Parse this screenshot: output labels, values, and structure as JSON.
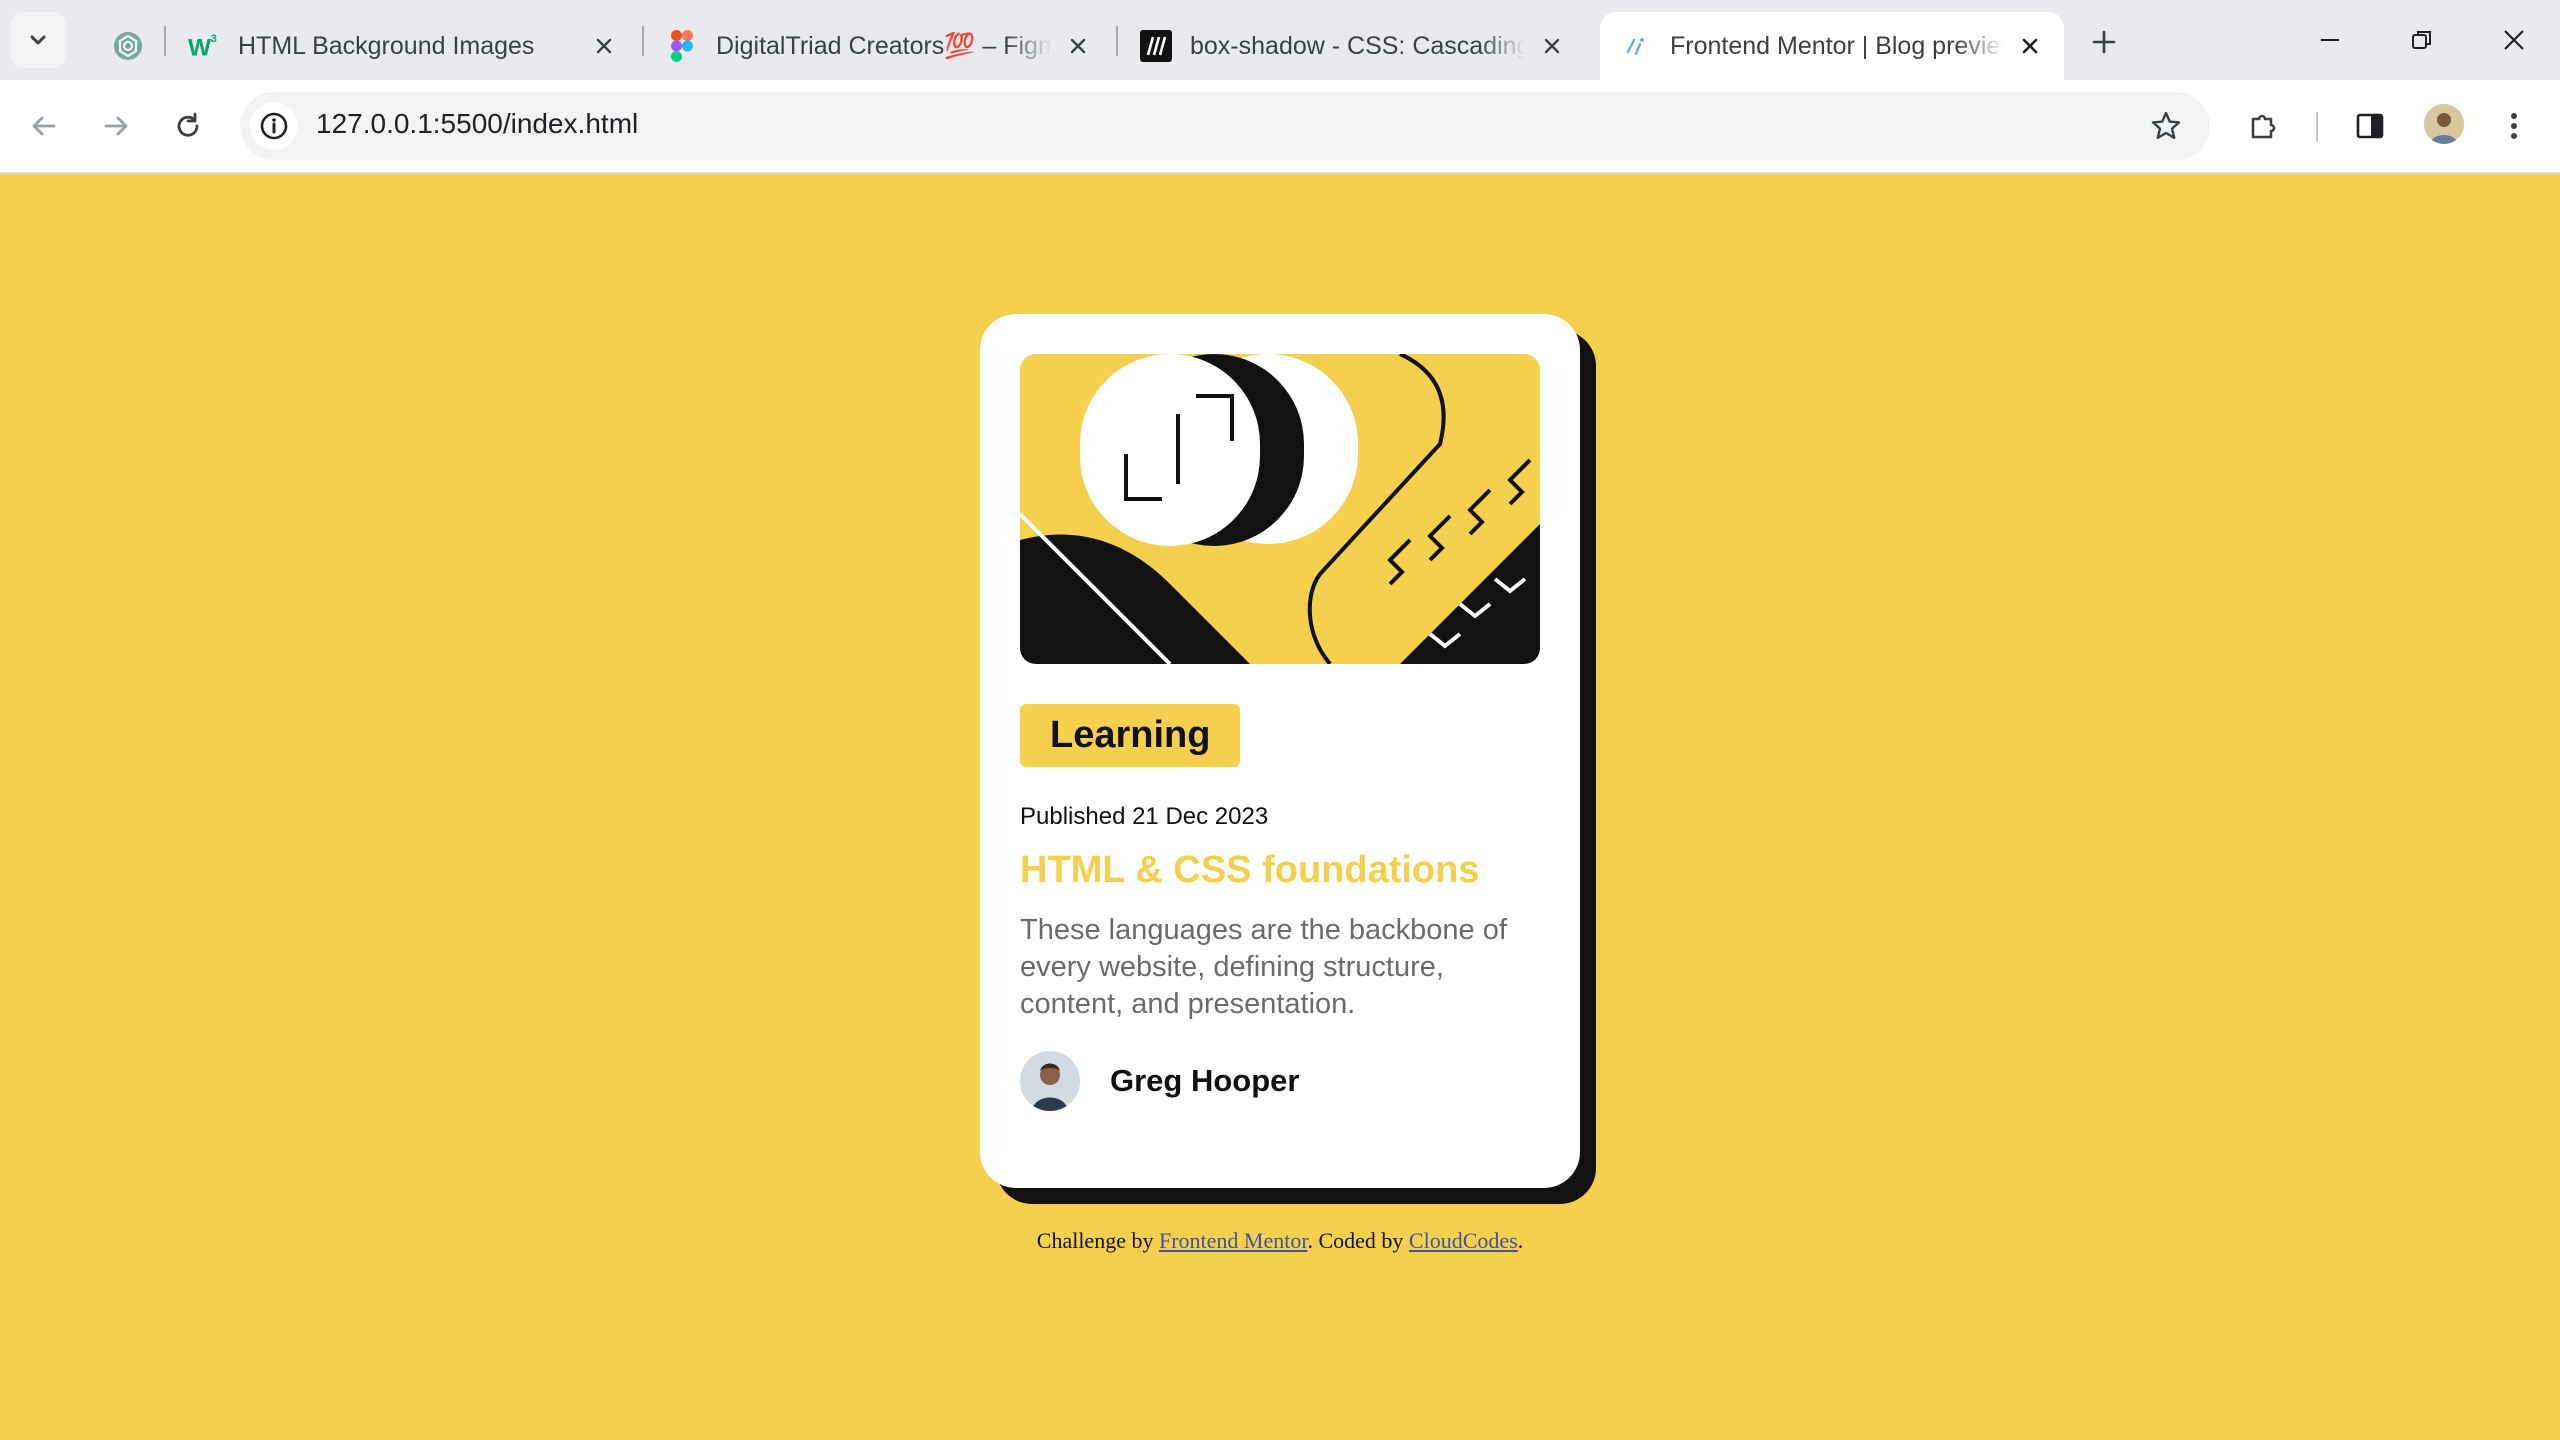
{
  "browser": {
    "tabs": [
      {
        "title": "",
        "favicon": "chatgpt-icon"
      },
      {
        "title": "HTML Background Images",
        "favicon": "w3schools-icon"
      },
      {
        "title": "DigitalTriad Creators💯 – Figma",
        "favicon": "figma-icon"
      },
      {
        "title": "box-shadow - CSS: Cascading Style Sheets",
        "favicon": "mdn-icon"
      },
      {
        "title": "Frontend Mentor | Blog preview card",
        "favicon": "vscode-live-server-icon",
        "active": true
      }
    ],
    "url": "127.0.0.1:5500/index.html"
  },
  "page": {
    "background_color": "#f4d04e",
    "card": {
      "badge": "Learning",
      "published": "Published 21 Dec 2023",
      "title": "HTML & CSS foundations",
      "description": "These languages are the backbone of every website, defining structure, content, and presentation.",
      "author": "Greg Hooper",
      "accent_color": "#f4d04e",
      "shadow_color": "#111111"
    },
    "attribution": {
      "prefix": "Challenge by ",
      "link1": "Frontend Mentor",
      "middle": ". Coded by ",
      "link2": "CloudCodes",
      "suffix": "."
    }
  }
}
